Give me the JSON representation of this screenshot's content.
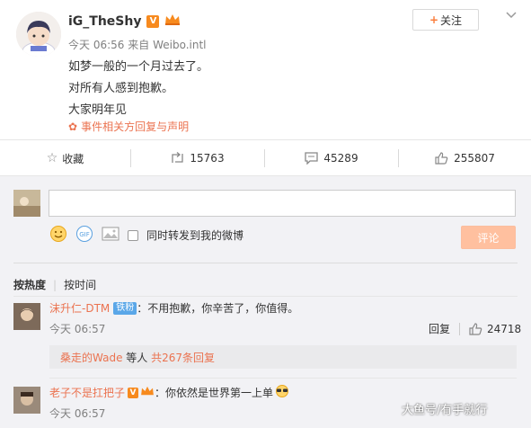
{
  "post": {
    "username": "iG_TheShy",
    "time": "今天 06:56",
    "source_prefix": "来自",
    "source": "Weibo.intl",
    "lines": [
      "如梦一般的一个月过去了。",
      "对所有人感到抱歉。",
      "大家明年见"
    ],
    "related_link": "事件相关方回复与声明",
    "follow_label": "关注"
  },
  "actions": {
    "favorite_label": "收藏",
    "repost_count": "15763",
    "comment_count": "45289",
    "like_count": "255807"
  },
  "composer": {
    "placeholder": "",
    "forward_label": "同时转发到我的微博",
    "submit_label": "评论"
  },
  "sort": {
    "hot_label": "按热度",
    "time_label": "按时间"
  },
  "comments": [
    {
      "name": "沫升仁-DTM",
      "badge": "铁粉",
      "text": "：不用抱歉，你辛苦了，你值得。",
      "time": "今天 06:57",
      "reply_label": "回复",
      "likes": "24718",
      "sub_user": "桑走的Wade",
      "sub_mid": " 等人 ",
      "sub_count": "共267条回复"
    },
    {
      "name": "老子不是扛把子",
      "text": "：你依然是世界第一上单",
      "time": "今天 06:57"
    }
  ],
  "watermark": "大鱼号/有手就行",
  "colors": {
    "accent": "#eb7350",
    "orange": "#fa7d3c",
    "vip": "#f78a1e",
    "link_blue": "#eb7350"
  }
}
